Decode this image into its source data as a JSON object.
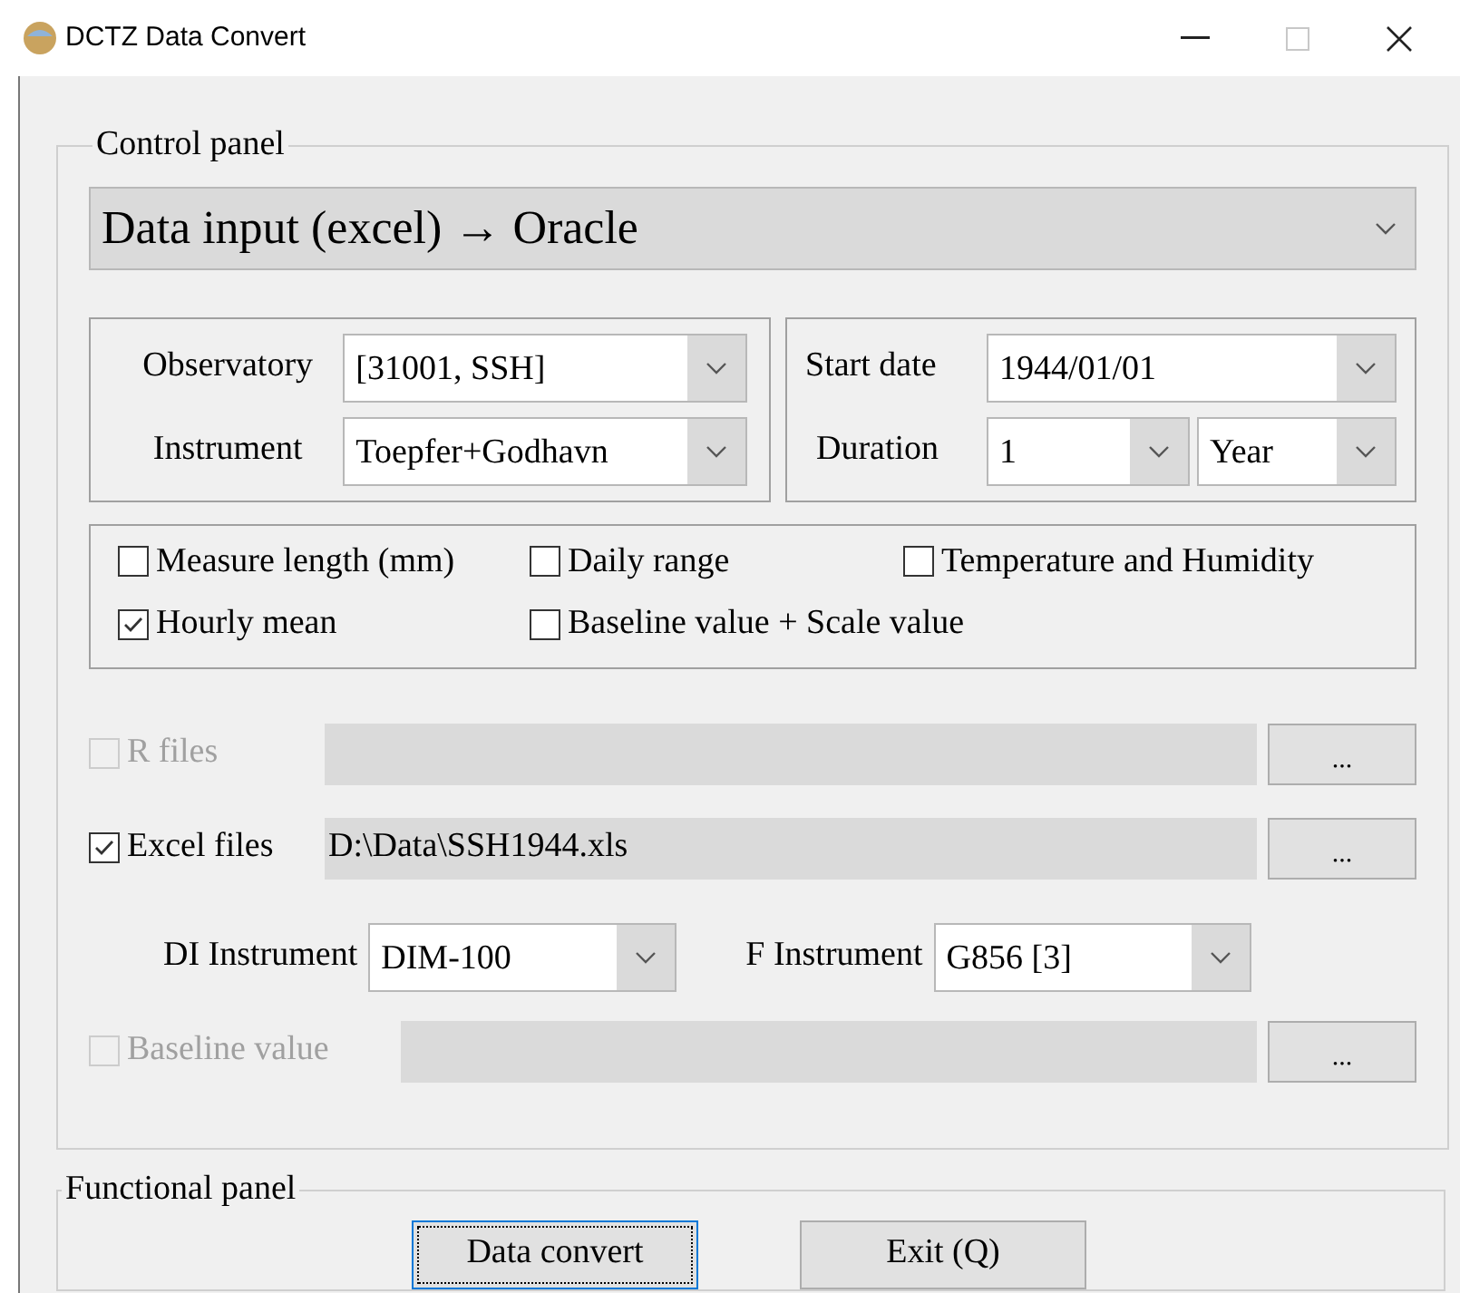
{
  "window": {
    "title": "DCTZ Data Convert"
  },
  "control_panel": {
    "title": "Control panel",
    "mode": {
      "value": "Data input (excel) → Oracle"
    },
    "station": [
      {
        "label": "Observatory",
        "value": "[31001, SSH]"
      },
      {
        "label": "Instrument",
        "value": "Toepfer+Godhavn"
      }
    ],
    "period": {
      "start_label": "Start date",
      "start_value": "1944/01/01",
      "duration_label": "Duration",
      "duration_value": "1",
      "unit_value": "Year"
    },
    "options": [
      [
        {
          "label": "Measure length (mm)",
          "checked": false
        },
        {
          "label": "Daily range",
          "checked": false
        },
        {
          "label": "Temperature and Humidity",
          "checked": false
        }
      ],
      [
        {
          "label": "Hourly mean",
          "checked": true
        },
        {
          "label": "Baseline value + Scale value",
          "checked": false
        }
      ]
    ],
    "files": [
      {
        "label": "R files",
        "checked": false,
        "disabled": true,
        "browse": "..."
      },
      {
        "label": "Excel files",
        "checked": true,
        "disabled": false,
        "path": "D:\\Data\\SSH1944.xls",
        "browse": "..."
      }
    ],
    "instruments": [
      {
        "label": "DI Instrument",
        "value": "DIM-100"
      },
      {
        "label": "F Instrument",
        "value": "G856 [3]"
      }
    ],
    "baseline": {
      "label": "Baseline value",
      "checked": false,
      "disabled": true,
      "browse": "..."
    }
  },
  "functional_panel": {
    "title": "Functional panel",
    "buttons": [
      {
        "label": "Data convert",
        "focused": true
      },
      {
        "label": "Exit (Q)",
        "focused": false
      }
    ]
  }
}
